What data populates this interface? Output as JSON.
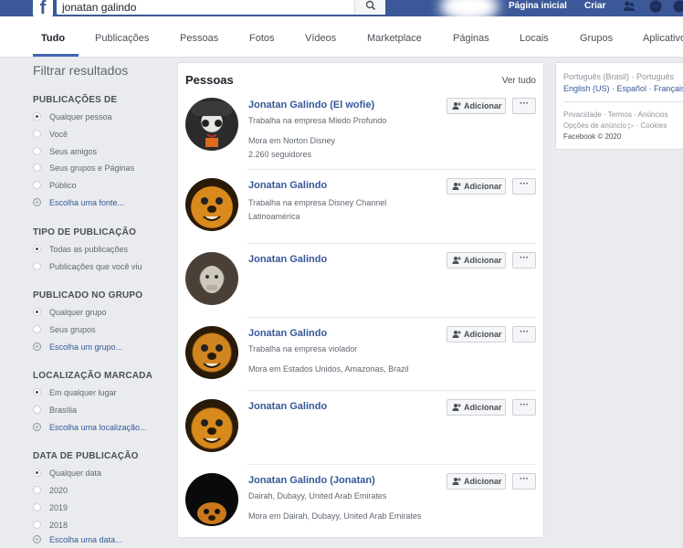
{
  "header": {
    "logo": "f",
    "search_value": "jonatan galindo",
    "home_label": "Página inicial",
    "create_label": "Criar"
  },
  "tabs": [
    "Tudo",
    "Publicações",
    "Pessoas",
    "Fotos",
    "Vídeos",
    "Marketplace",
    "Páginas",
    "Locais",
    "Grupos",
    "Aplicativos"
  ],
  "filters": {
    "title": "Filtrar resultados",
    "sections": [
      {
        "title": "PUBLICAÇÕES DE",
        "options": [
          "Qualquer pessoa",
          "Você",
          "Seus amigos",
          "Seus grupos e Páginas",
          "Público"
        ],
        "extra": "Escolha uma fonte..."
      },
      {
        "title": "TIPO DE PUBLICAÇÃO",
        "options": [
          "Todas as publicações",
          "Publicações que você viu"
        ]
      },
      {
        "title": "PUBLICADO NO GRUPO",
        "options": [
          "Qualquer grupo",
          "Seus grupos"
        ],
        "extra": "Escolha um grupo..."
      },
      {
        "title": "LOCALIZAÇÃO MARCADA",
        "options": [
          "Em qualquer lugar",
          "Brasília"
        ],
        "extra": "Escolha uma localização..."
      },
      {
        "title": "DATA DE PUBLICAÇÃO",
        "options": [
          "Qualquer data",
          "2020",
          "2019",
          "2018"
        ],
        "extra": "Escolha uma data..."
      }
    ]
  },
  "people": {
    "title": "Pessoas",
    "see_all": "Ver tudo",
    "add_label": "Adicionar",
    "more_label": "···",
    "results": [
      {
        "name": "Jonatan Galindo (El wofie)",
        "line1": "Trabalha na empresa Miedo Profundo",
        "line2": "Mora em Norton Disney",
        "line3": "2.260 seguidores"
      },
      {
        "name": "Jonatan Galindo",
        "line1": "Trabalha na empresa Disney Channel Latinoamérica",
        "line2": "",
        "line3": ""
      },
      {
        "name": "Jonatan Galindo",
        "line1": "",
        "line2": "",
        "line3": ""
      },
      {
        "name": "Jonatan Galindo",
        "line1": "Trabalha na empresa violador",
        "line2": "Mora em Estados Unidos, Amazonas, Brazil",
        "line3": ""
      },
      {
        "name": "Jonatan Galindo",
        "line1": "",
        "line2": "",
        "line3": ""
      },
      {
        "name": "Jonatan Galindo (Jonatan)",
        "line1": "Dairah, Dubayy, United Arab Emirates",
        "line2": "Mora em Dairah, Dubayy, United Arab Emirates",
        "line3": ""
      }
    ]
  },
  "sidebar_right": {
    "lang_line1": "Português (Brasil) · Português",
    "lang_line2": "English (US) · Español · Français",
    "footer_line1": "Privacidade · Termos · Anúncios",
    "footer_line2": "Opções de anúncio ▷ · Cookies",
    "footer_line3": "Facebook © 2020"
  },
  "colors": {
    "brand": "#3b5998",
    "link": "#365899"
  }
}
